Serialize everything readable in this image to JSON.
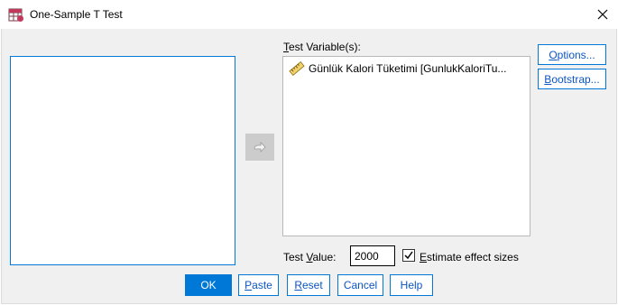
{
  "window": {
    "title": "One-Sample T Test",
    "close_symbol": "✕"
  },
  "source_list": {
    "items": []
  },
  "move_button": {
    "icon": "arrow-right-icon"
  },
  "target": {
    "label_mnemonic": "T",
    "label_rest": "est Variable(s):",
    "variables": [
      {
        "label": "Günlük Kalori Tüketimi [GunlukKaloriTu...",
        "icon": "scale-variable-icon"
      }
    ]
  },
  "side_buttons": {
    "options": {
      "mnemonic": "O",
      "rest": "ptions..."
    },
    "bootstrap": {
      "mnemonic": "B",
      "rest": "ootstrap..."
    }
  },
  "test_value": {
    "label_pre": "Test ",
    "label_mnemonic": "V",
    "label_post": "alue:",
    "value": "2000"
  },
  "effect_sizes": {
    "checked": true,
    "mnemonic": "E",
    "rest": "stimate effect sizes"
  },
  "buttons": {
    "ok": "OK",
    "paste": {
      "mnemonic": "P",
      "rest": "aste"
    },
    "reset": {
      "mnemonic": "R",
      "rest": "eset"
    },
    "cancel": "Cancel",
    "help": "Help"
  },
  "colors": {
    "accent": "#0078d7",
    "link_text": "#0b55c4",
    "dialog_bg": "#f0f0f0"
  }
}
